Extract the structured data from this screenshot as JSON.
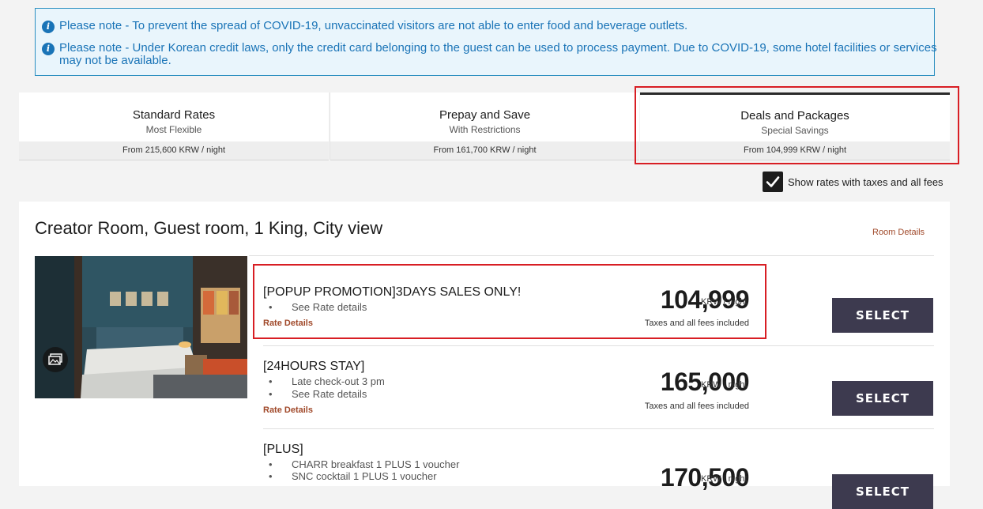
{
  "notices": [
    {
      "icon": "info-icon",
      "text": "Please note - To prevent the spread of COVID-19, unvaccinated visitors are not able to enter food and beverage outlets."
    },
    {
      "icon": "info-icon",
      "text": "Please note - Under Korean credit laws, only the credit card belonging to the guest can be used to process payment. Due to COVID-19, some hotel facilities or services may not be available."
    }
  ],
  "tabs": [
    {
      "name": "Standard Rates",
      "subtitle": "Most Flexible",
      "from": "From 215,600 KRW / night"
    },
    {
      "name": "Prepay and Save",
      "subtitle": "With Restrictions",
      "from": "From 161,700 KRW / night"
    },
    {
      "name": "Deals and Packages",
      "subtitle": "Special Savings",
      "from": "From 104,999 KRW / night",
      "active": true
    }
  ],
  "taxes_toggle": {
    "label": "Show rates with taxes and all fees",
    "checked": true
  },
  "room": {
    "title": "Creator Room, Guest room, 1 King, City view",
    "details_link": "Room Details",
    "gallery_icon": "gallery-icon"
  },
  "rates": [
    {
      "name": "[POPUP PROMOTION]3DAYS SALES ONLY!",
      "bullets": [
        "See Rate details"
      ],
      "link": "Rate Details",
      "price": "104,999",
      "unit": "KRW / night",
      "tax_note": "Taxes and all fees included",
      "button": "SELECT"
    },
    {
      "name": "[24HOURS STAY]",
      "bullets": [
        "Late check-out 3 pm",
        "See Rate details"
      ],
      "link": "Rate Details",
      "price": "165,000",
      "unit": "KRW / night",
      "tax_note": "Taxes and all fees included",
      "button": "SELECT"
    },
    {
      "name": "[PLUS]",
      "bullets": [
        "CHARR breakfast 1 PLUS 1 voucher",
        "SNC cocktail 1 PLUS 1 voucher"
      ],
      "price": "170,500",
      "unit": "KRW / night",
      "button": "SELECT"
    }
  ],
  "colors": {
    "accent_link": "#a0492a",
    "info_blue": "#1a74b7",
    "highlight_red": "#d81e24",
    "button_bg": "#3d3a4f"
  }
}
